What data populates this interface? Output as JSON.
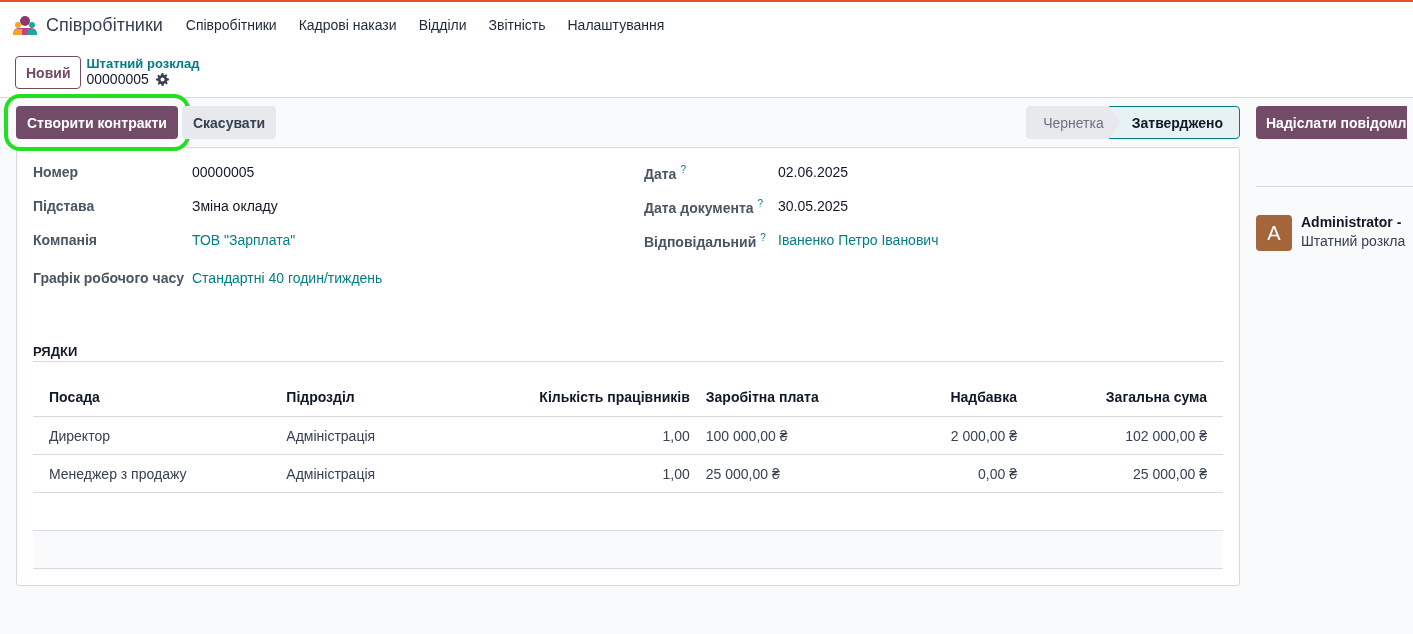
{
  "app": {
    "name": "Співробітники"
  },
  "menu": [
    {
      "label": "Співробітники"
    },
    {
      "label": "Кадрові накази"
    },
    {
      "label": "Відділи"
    },
    {
      "label": "Звітність"
    },
    {
      "label": "Налаштування"
    }
  ],
  "control_panel": {
    "new_button": "Новий",
    "breadcrumb": "Штатний розклад",
    "record": "00000005"
  },
  "actions": [
    {
      "label": "Створити контракти",
      "kind": "primary",
      "highlighted": true
    },
    {
      "label": "Скасувати",
      "kind": "secondary",
      "highlighted": false
    }
  ],
  "statusbar": [
    {
      "label": "Чернетка",
      "selected": false
    },
    {
      "label": "Затверджено",
      "selected": true
    }
  ],
  "fields_left": [
    {
      "label": "Номер",
      "value": "00000005",
      "link": false
    },
    {
      "label": "Підстава",
      "value": "Зміна окладу",
      "link": false
    },
    {
      "label": "Компанія",
      "value": "ТОВ \"Зарплата\"",
      "link": true
    },
    {
      "label": "Графік робочого часу",
      "value": "Стандартні 40 годин/тиждень",
      "link": true
    }
  ],
  "fields_right": [
    {
      "label": "Дата",
      "help": "?",
      "value": "02.06.2025",
      "link": false
    },
    {
      "label": "Дата документа",
      "help": "?",
      "value": "30.05.2025",
      "link": false
    },
    {
      "label": "Відповідальний",
      "help": "?",
      "value": "Іваненко Петро Іванович",
      "link": true
    }
  ],
  "section_title": "РЯДКИ",
  "table": {
    "columns": [
      "Посада",
      "Підрозділ",
      "Кількість працівників",
      "Заробітна плата",
      "Надбавка",
      "Загальна сума"
    ],
    "rows": [
      [
        "Директор",
        "Адміністрація",
        "1,00",
        "100 000,00 ₴",
        "2 000,00 ₴",
        "102 000,00 ₴"
      ],
      [
        "Менеджер з продажу",
        "Адміністрація",
        "1,00",
        "25 000,00 ₴",
        "0,00 ₴",
        "25 000,00 ₴"
      ]
    ]
  },
  "chatter": {
    "send_button": "Надіслати повідомл",
    "messages": [
      {
        "avatar": "A",
        "author": "Administrator -",
        "text": "Штатний розкла"
      }
    ]
  }
}
